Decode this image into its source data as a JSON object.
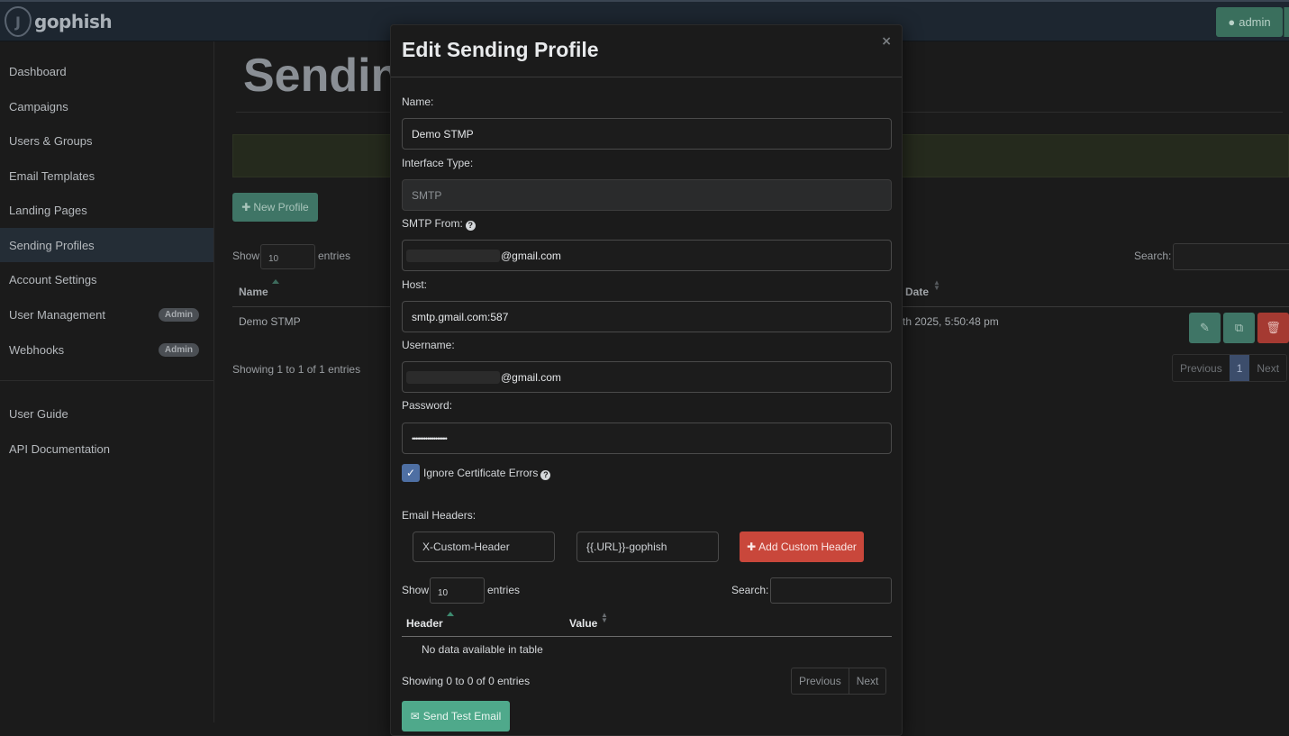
{
  "app": {
    "name": "gophish",
    "logo_letter": "J"
  },
  "navbar": {
    "user_label": "admin",
    "user_icon": "user-icon"
  },
  "sidebar": {
    "items": [
      {
        "label": "Dashboard"
      },
      {
        "label": "Campaigns"
      },
      {
        "label": "Users & Groups"
      },
      {
        "label": "Email Templates"
      },
      {
        "label": "Landing Pages"
      },
      {
        "label": "Sending Profiles",
        "active": true
      },
      {
        "label": "Account Settings"
      },
      {
        "label": "User Management",
        "badge": "Admin"
      },
      {
        "label": "Webhooks",
        "badge": "Admin"
      }
    ],
    "secondary": [
      {
        "label": "User Guide"
      },
      {
        "label": "API Documentation"
      }
    ]
  },
  "page": {
    "title": "Sending",
    "new_button": "New Profile",
    "table": {
      "show_label": "Show",
      "entries_label": "entries",
      "page_size": "10",
      "search_label": "Search:",
      "columns": [
        "Name",
        "Date"
      ],
      "rows": [
        {
          "name": "Demo STMP",
          "date": "th 2025, 5:50:48 pm"
        }
      ],
      "info": "Showing 1 to 1 of 1 entries",
      "pagination": {
        "previous": "Previous",
        "current": "1",
        "next": "Next"
      }
    }
  },
  "modal": {
    "title": "Edit Sending Profile",
    "close": "×",
    "fields": {
      "name": {
        "label": "Name:",
        "value": "Demo STMP"
      },
      "interface_type": {
        "label": "Interface Type:",
        "value": "SMTP"
      },
      "smtp_from": {
        "label": "SMTP From:",
        "value": "@gmail.com"
      },
      "host": {
        "label": "Host:",
        "value": "smtp.gmail.com:587"
      },
      "username": {
        "label": "Username:",
        "value": "@gmail.com"
      },
      "password": {
        "label": "Password:",
        "value": "••••••••••••••••••"
      }
    },
    "ignore_cert": {
      "label": "Ignore Certificate Errors",
      "checked": true
    },
    "headers": {
      "label": "Email Headers:",
      "header_input": "X-Custom-Header",
      "value_input": "{{.URL}}-gophish",
      "add_button": "Add Custom Header",
      "show_label": "Show",
      "page_size": "10",
      "entries_label": "entries",
      "search_label": "Search:",
      "columns": [
        "Header",
        "Value"
      ],
      "empty": "No data available in table",
      "info": "Showing 0 to 0 of 0 entries",
      "pagination": {
        "previous": "Previous",
        "next": "Next"
      }
    },
    "send_test_button": "Send Test Email"
  },
  "colors": {
    "navbar": "#1d2630",
    "success": "#4fa98b",
    "danger": "#c9473b",
    "primary": "#4e6fa3"
  }
}
